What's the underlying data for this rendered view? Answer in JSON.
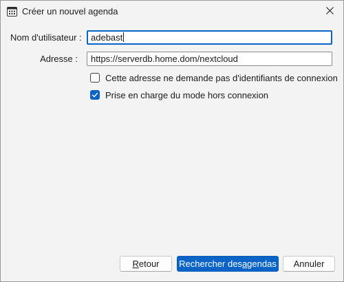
{
  "window": {
    "title": "Créer un nouvel agenda",
    "app_icon": "calendar-icon",
    "close_icon": "close-icon"
  },
  "form": {
    "username": {
      "label": "Nom d'utilisateur :",
      "value": "adebast"
    },
    "address": {
      "label": "Adresse :",
      "value": "https://serverdb.home.dom/nextcloud"
    },
    "no_credentials": {
      "label": "Cette adresse ne demande pas d'identifiants de connexion",
      "checked": false
    },
    "offline_support": {
      "label": "Prise en charge du mode hors connexion",
      "checked": true
    }
  },
  "buttons": {
    "back": {
      "prefix": "",
      "accel": "R",
      "rest": "etour"
    },
    "search": {
      "prefix": "Rechercher des ",
      "accel": "a",
      "rest": "gendas"
    },
    "cancel": {
      "label": "Annuler"
    }
  },
  "colors": {
    "accent": "#0a64c8",
    "background": "#f3f3f3"
  }
}
